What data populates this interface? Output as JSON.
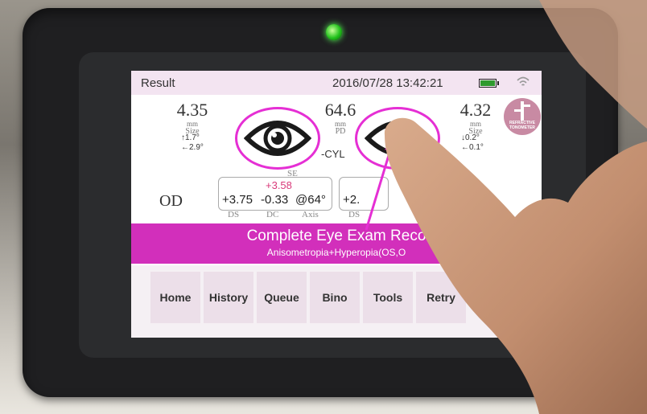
{
  "status": {
    "title": "Result",
    "datetime": "2016/07/28 13:42:21"
  },
  "left_eye_meas": {
    "size": "4.35",
    "size_unit": "mm",
    "size_label": "Size",
    "deg1": "↑1.7°",
    "deg2": "←2.9°"
  },
  "pd": {
    "value": "64.6",
    "unit": "mm",
    "label": "PD"
  },
  "right_eye_meas": {
    "size": "4.32",
    "size_unit": "mm",
    "size_label": "Size",
    "deg1": "↓0.2°",
    "deg2": "←0.1°"
  },
  "cyl_label": "-CYL",
  "refraction": {
    "eye": "OD",
    "sp_label": "SE",
    "sp": "+3.58",
    "ds": "+3.75",
    "dc": "-0.33",
    "axis": "@64°",
    "ds_label": "DS",
    "dc_label": "DC",
    "axis_label": "Axis",
    "os_ds": "+2.",
    "os_ds_label": "DS"
  },
  "banner": {
    "title": "Complete Eye Exam Reco",
    "subtitle": "Anisometropia+Hyperopia(OS,O"
  },
  "nav": [
    "Home",
    "History",
    "Queue",
    "Bino",
    "Tools",
    "Retry"
  ],
  "logo_text": "REFRACTIVE TONOMETER",
  "colors": {
    "accent": "#d22fbb",
    "annotation": "#e52fd4"
  }
}
